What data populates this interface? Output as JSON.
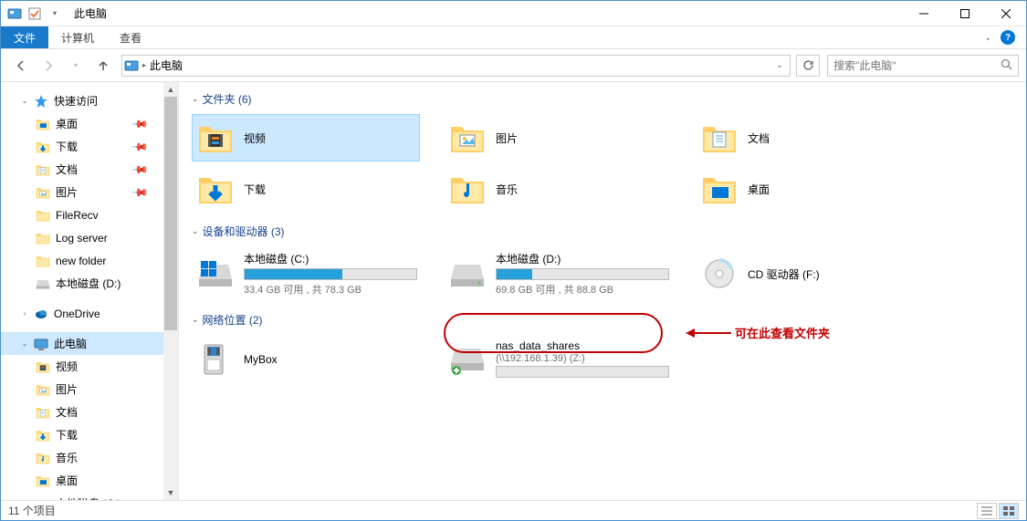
{
  "window": {
    "title": "此电脑"
  },
  "ribbon": {
    "file": "文件",
    "computer": "计算机",
    "view": "查看"
  },
  "address": {
    "location": "此电脑"
  },
  "search": {
    "placeholder": "搜索\"此电脑\""
  },
  "sidebar": {
    "quick_access": "快速访问",
    "items_quick": [
      {
        "label": "桌面",
        "icon": "desktop",
        "pinned": true
      },
      {
        "label": "下载",
        "icon": "downloads",
        "pinned": true
      },
      {
        "label": "文档",
        "icon": "documents",
        "pinned": true
      },
      {
        "label": "图片",
        "icon": "pictures",
        "pinned": true
      },
      {
        "label": "FileRecv",
        "icon": "folder",
        "pinned": false
      },
      {
        "label": "Log server",
        "icon": "folder",
        "pinned": false
      },
      {
        "label": "new folder",
        "icon": "folder",
        "pinned": false
      },
      {
        "label": "本地磁盘 (D:)",
        "icon": "drive",
        "pinned": false
      }
    ],
    "onedrive": "OneDrive",
    "this_pc": "此电脑",
    "items_pc": [
      {
        "label": "视频",
        "icon": "videos"
      },
      {
        "label": "图片",
        "icon": "pictures"
      },
      {
        "label": "文档",
        "icon": "documents"
      },
      {
        "label": "下载",
        "icon": "downloads"
      },
      {
        "label": "音乐",
        "icon": "music"
      },
      {
        "label": "桌面",
        "icon": "desktop"
      },
      {
        "label": "本地磁盘 (C:)",
        "icon": "drive"
      }
    ]
  },
  "content": {
    "group_folders": {
      "header": "文件夹 (6)",
      "items": [
        {
          "label": "视频",
          "icon": "videos"
        },
        {
          "label": "图片",
          "icon": "pictures"
        },
        {
          "label": "文档",
          "icon": "documents"
        },
        {
          "label": "下载",
          "icon": "downloads"
        },
        {
          "label": "音乐",
          "icon": "music"
        },
        {
          "label": "桌面",
          "icon": "desktop"
        }
      ]
    },
    "group_drives": {
      "header": "设备和驱动器 (3)",
      "items": [
        {
          "label": "本地磁盘 (C:)",
          "sub": "33.4 GB 可用 , 共 78.3 GB",
          "fill": 57
        },
        {
          "label": "本地磁盘 (D:)",
          "sub": "69.8 GB 可用 , 共 88.8 GB",
          "fill": 21
        },
        {
          "label": "CD 驱动器 (F:)",
          "sub": "",
          "fill": -1
        }
      ]
    },
    "group_network": {
      "header": "网络位置 (2)",
      "items": [
        {
          "label": "MyBox",
          "sub": ""
        },
        {
          "label": "nas_data_shares",
          "sub": "(\\\\192.168.1.39) (Z:)"
        }
      ]
    }
  },
  "status": {
    "text": "11 个项目"
  },
  "annotation": {
    "text": "可在此查看文件夹"
  }
}
